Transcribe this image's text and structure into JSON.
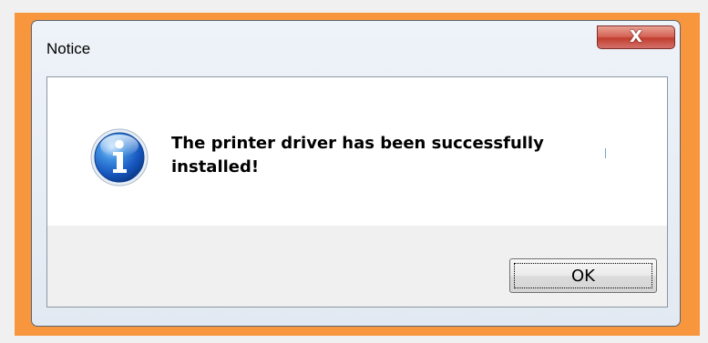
{
  "window": {
    "title": "Notice",
    "frame_color": "#f7963d"
  },
  "dialog": {
    "icon": "info-icon",
    "message": "The printer driver has been successfully installed!"
  },
  "buttons": {
    "close_label": "X",
    "ok_label": "OK"
  }
}
